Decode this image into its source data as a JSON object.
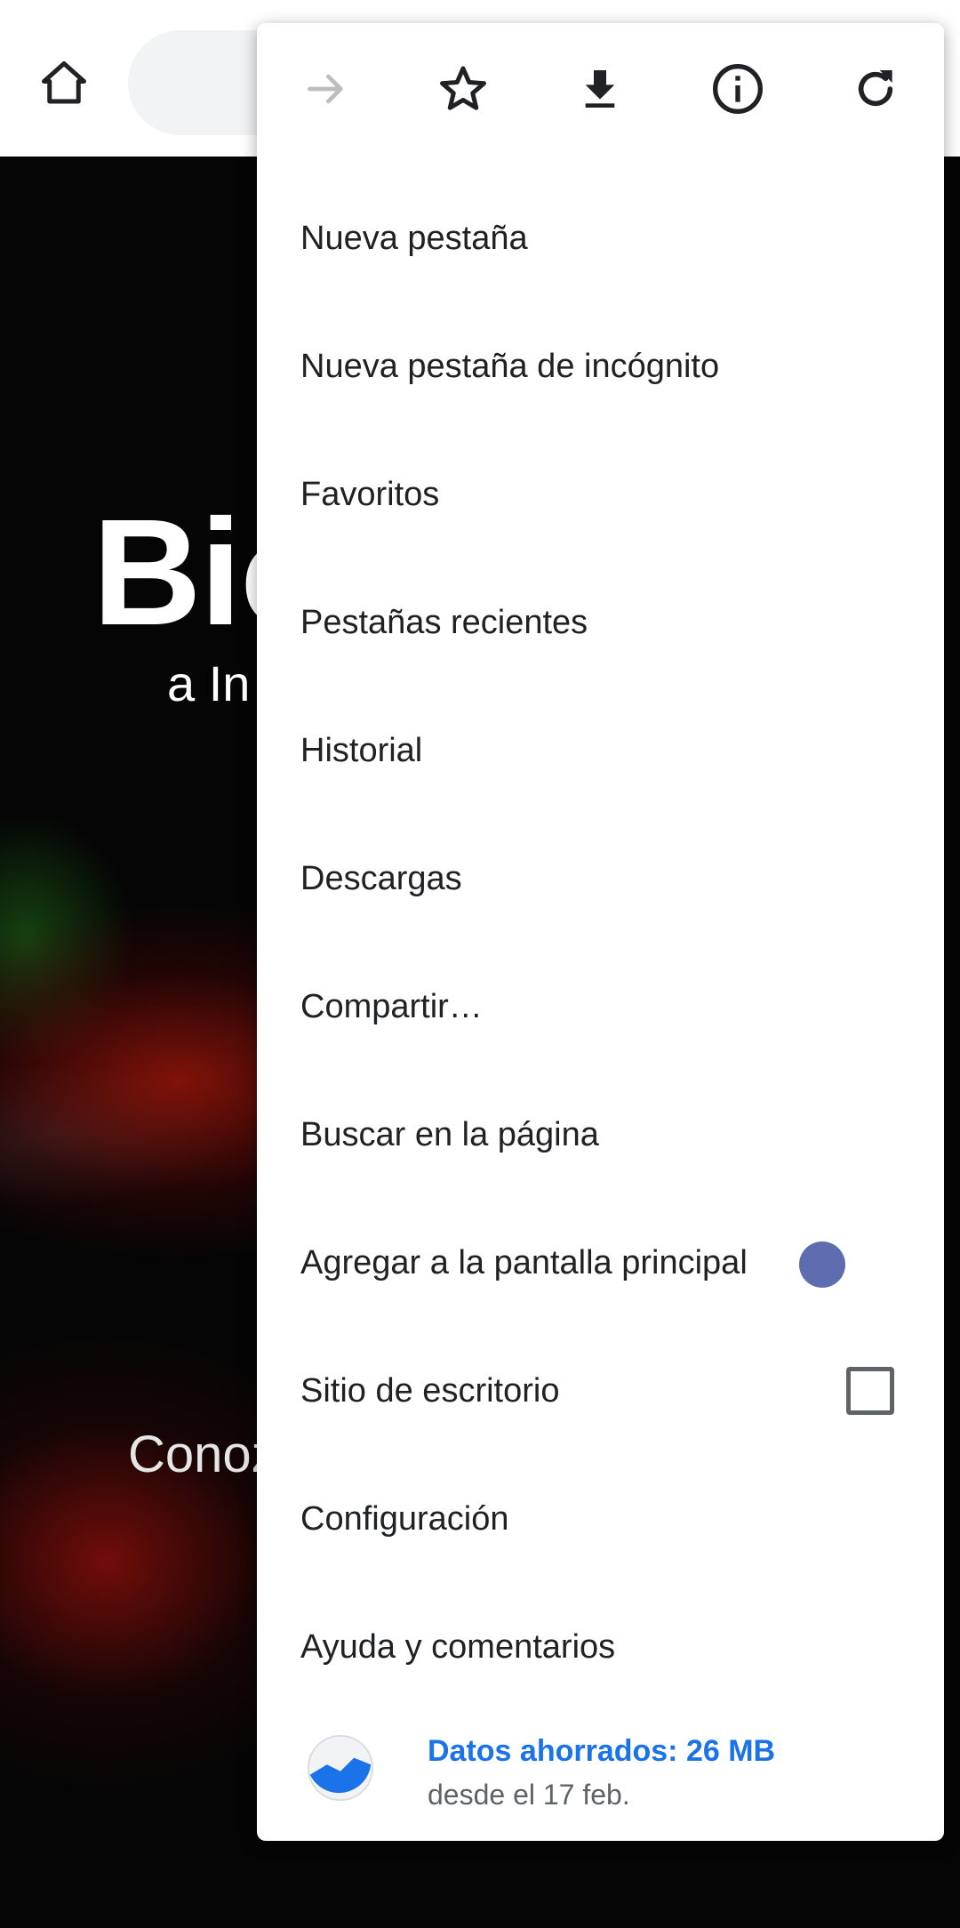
{
  "page": {
    "hero_title": "Bio",
    "hero_subtitle": "a In",
    "hero_cta": "Conoz"
  },
  "toolbar": {
    "icons": [
      "forward-arrow-icon",
      "star-icon",
      "download-icon",
      "info-icon",
      "reload-icon"
    ]
  },
  "menu": {
    "items": [
      {
        "label": "Nueva pestaña"
      },
      {
        "label": "Nueva pestaña de incógnito"
      },
      {
        "label": "Favoritos"
      },
      {
        "label": "Pestañas recientes"
      },
      {
        "label": "Historial"
      },
      {
        "label": "Descargas"
      },
      {
        "label": "Compartir…"
      },
      {
        "label": "Buscar en la página"
      },
      {
        "label": "Agregar a la pantalla principal"
      },
      {
        "label": "Sitio de escritorio",
        "checked": false
      },
      {
        "label": "Configuración"
      },
      {
        "label": "Ayuda y comentarios"
      }
    ]
  },
  "data_saver": {
    "title": "Datos ahorrados: 26 MB",
    "subtitle": "desde el 17 feb."
  },
  "colors": {
    "accent": "#1a73e8",
    "text": "#202124",
    "icon": "#202124",
    "disabled_icon": "#bdbdbd"
  }
}
